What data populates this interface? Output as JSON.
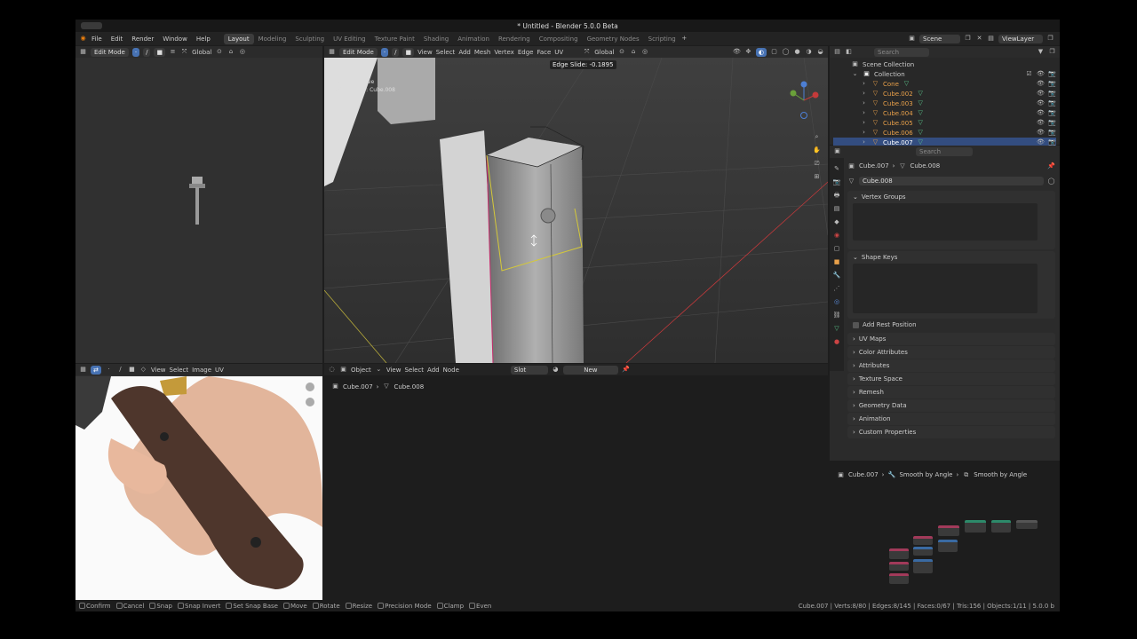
{
  "window": {
    "title": "* Untitled - Blender 5.0.0 Beta"
  },
  "menu": [
    "File",
    "Edit",
    "Render",
    "Window",
    "Help"
  ],
  "workspaces": [
    {
      "label": "Layout",
      "active": true
    },
    {
      "label": "Modeling"
    },
    {
      "label": "Sculpting"
    },
    {
      "label": "UV Editing"
    },
    {
      "label": "Texture Paint"
    },
    {
      "label": "Shading"
    },
    {
      "label": "Animation"
    },
    {
      "label": "Rendering"
    },
    {
      "label": "Compositing"
    },
    {
      "label": "Geometry Nodes"
    },
    {
      "label": "Scripting"
    }
  ],
  "scene": {
    "name": "Scene",
    "view_layer": "ViewLayer"
  },
  "uv_view": {
    "mode": "Edit Mode",
    "transform": "Global"
  },
  "viewport": {
    "mode": "Edit Mode",
    "menus": [
      "View",
      "Select",
      "Add",
      "Mesh",
      "Vertex",
      "Edge",
      "Face",
      "UV"
    ],
    "transform": "Global",
    "op_readout": "Edge Slide: -0.1895",
    "overlay_text_1": "User Perspective",
    "overlay_text_2": "(1) Cube.007 : Cube.008"
  },
  "image_editor": {
    "menus": [
      "View",
      "Select",
      "Image",
      "UV"
    ]
  },
  "node_editor": {
    "type": "Object",
    "menus": [
      "View",
      "Select",
      "Add",
      "Node"
    ],
    "slot": "Slot",
    "new_label": "New",
    "breadcrumb": [
      "Cube.007",
      "Cube.008"
    ]
  },
  "outliner": {
    "search_placeholder": "Search",
    "root": "Scene Collection",
    "collection": "Collection",
    "items": [
      {
        "name": "Cone",
        "selected": false
      },
      {
        "name": "Cube.002",
        "selected": false
      },
      {
        "name": "Cube.003",
        "selected": false
      },
      {
        "name": "Cube.004",
        "selected": false
      },
      {
        "name": "Cube.005",
        "selected": false
      },
      {
        "name": "Cube.006",
        "selected": false
      },
      {
        "name": "Cube.007",
        "selected": true
      }
    ]
  },
  "properties": {
    "search_placeholder": "Search",
    "object": "Cube.007",
    "mesh": "Cube.008",
    "mesh_field": "Cube.008",
    "vertex_groups": "Vertex Groups",
    "shape_keys": "Shape Keys",
    "add_rest_position": "Add Rest Position",
    "sections": [
      "UV Maps",
      "Color Attributes",
      "Attributes",
      "Texture Space",
      "Remesh",
      "Geometry Data",
      "Animation",
      "Custom Properties"
    ]
  },
  "geo_nodes": {
    "breadcrumb": [
      "Cube.007",
      "Smooth by Angle",
      "Smooth by Angle"
    ]
  },
  "statusbar": {
    "hints": [
      "Confirm",
      "Cancel",
      "Snap",
      "Snap Invert",
      "Set Snap Base",
      "Move",
      "Rotate",
      "Resize",
      "Precision Mode",
      "Clamp",
      "Even"
    ],
    "stats": "Cube.007 | Verts:8/80 | Edges:8/145 | Faces:0/67 | Tris:156 | Objects:1/11 | 5.0.0 b"
  },
  "colors": {
    "accent": "#4772b3",
    "selection": "#334d80",
    "header": "#2b2b2b",
    "panel": "#303030"
  },
  "icons": [
    "blender-logo-icon",
    "editor-type-icon",
    "search-icon",
    "eye-icon",
    "camera-icon",
    "mesh-icon",
    "modifier-wrench-icon",
    "zoom-icon",
    "hand-pan-icon",
    "camera-view-icon",
    "grid-icon",
    "axis-gizmo-icon",
    "pin-icon",
    "plus-icon",
    "chevron-down-icon",
    "filter-icon"
  ]
}
